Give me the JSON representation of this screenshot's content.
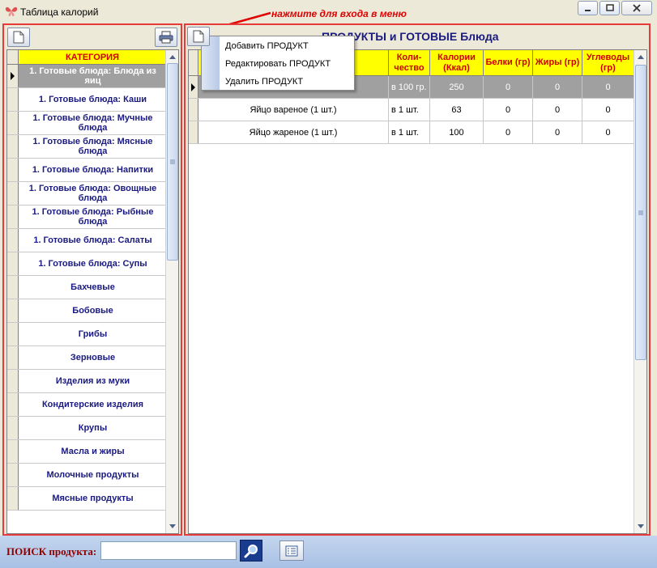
{
  "window": {
    "title": "Таблица калорий"
  },
  "annotation": {
    "text": "нажмите для входа в меню"
  },
  "left": {
    "header": "КАТЕГОРИЯ",
    "categories": [
      "1. Готовые блюда: Блюда из яиц",
      "1. Готовые блюда: Каши",
      "1. Готовые блюда: Мучные блюда",
      "1. Готовые блюда: Мясные блюда",
      "1. Готовые блюда: Напитки",
      "1. Готовые блюда: Овощные блюда",
      "1. Готовые блюда: Рыбные блюда",
      "1. Готовые блюда: Салаты",
      "1. Готовые блюда: Супы",
      "Бахчевые",
      "Бобовые",
      "Грибы",
      "Зерновые",
      "Изделия из муки",
      "Кондитерские изделия",
      "Крупы",
      "Масла и жиры",
      "Молочные продукты",
      "Мясные продукты"
    ],
    "selected_index": 0
  },
  "right": {
    "title": "ПРОДУКТЫ и ГОТОВЫЕ Блюда",
    "columns": {
      "qty": "Коли-чество",
      "cal": "Калории (Ккал)",
      "protein": "Белки (гр)",
      "fat": "Жиры (гр)",
      "carbs": "Углеводы (гр)"
    },
    "rows": [
      {
        "name": "",
        "qty": "в 100 гр.",
        "cal": "250",
        "protein": "0",
        "fat": "0",
        "carbs": "0"
      },
      {
        "name": "Яйцо вареное (1 шт.)",
        "qty": "в 1 шт.",
        "cal": "63",
        "protein": "0",
        "fat": "0",
        "carbs": "0"
      },
      {
        "name": "Яйцо жареное (1 шт.)",
        "qty": "в 1 шт.",
        "cal": "100",
        "protein": "0",
        "fat": "0",
        "carbs": "0"
      }
    ],
    "selected_index": 0
  },
  "context_menu": {
    "items": [
      "Добавить ПРОДУКТ",
      "Редактировать ПРОДУКТ",
      "Удалить ПРОДУКТ"
    ]
  },
  "search": {
    "label": "ПОИСК продукта:",
    "value": ""
  },
  "colors": {
    "panel_border": "#e83a3a",
    "header_bg": "#ffff00",
    "header_text": "#d00000",
    "category_text": "#1a1a80",
    "selected_row": "#a0a0a0"
  }
}
